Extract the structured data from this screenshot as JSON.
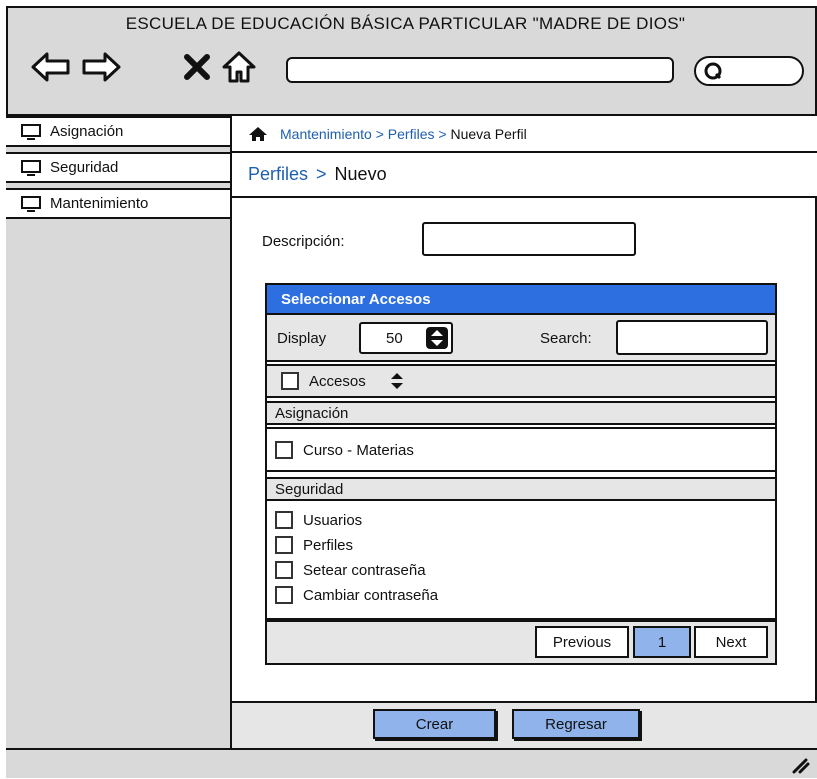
{
  "window": {
    "title": "ESCUELA DE EDUCACIÓN BÁSICA PARTICULAR \"MADRE DE DIOS\"",
    "nav_icons": [
      "back-arrow-icon",
      "forward-arrow-icon",
      "close-icon",
      "home-icon"
    ],
    "url_value": "",
    "search_value": ""
  },
  "sidebar": {
    "items": [
      {
        "label": "Asignación",
        "icon": "monitor-icon"
      },
      {
        "label": "Seguridad",
        "icon": "monitor-icon"
      },
      {
        "label": "Mantenimiento",
        "icon": "monitor-icon"
      }
    ]
  },
  "breadcrumb": {
    "icon": "home-icon",
    "items": [
      "Mantenimiento",
      "Perfiles",
      "Nueva Perfil"
    ],
    "separator": ">"
  },
  "heading": {
    "link": "Perfiles",
    "separator": ">",
    "current": "Nuevo"
  },
  "form": {
    "description_label": "Descripción:",
    "description_value": ""
  },
  "panel": {
    "title": "Seleccionar Accesos",
    "display_label": "Display",
    "display_value": "50",
    "search_label": "Search:",
    "search_value": "",
    "column_header": "Accesos",
    "groups": [
      {
        "name": "Asignación",
        "items": [
          "Curso - Materias"
        ]
      },
      {
        "name": "Seguridad",
        "items": [
          "Usuarios",
          "Perfiles",
          "Setear contraseña",
          "Cambiar contraseña"
        ]
      }
    ],
    "pager": {
      "previous": "Previous",
      "page": "1",
      "next": "Next"
    }
  },
  "footer": {
    "create_label": "Crear",
    "back_label": "Regresar"
  },
  "colors": {
    "panel_header": "#2d6fe0",
    "button_fill": "#8fb3ea",
    "link": "#1f5fb0",
    "chrome": "#d9d9d9"
  }
}
